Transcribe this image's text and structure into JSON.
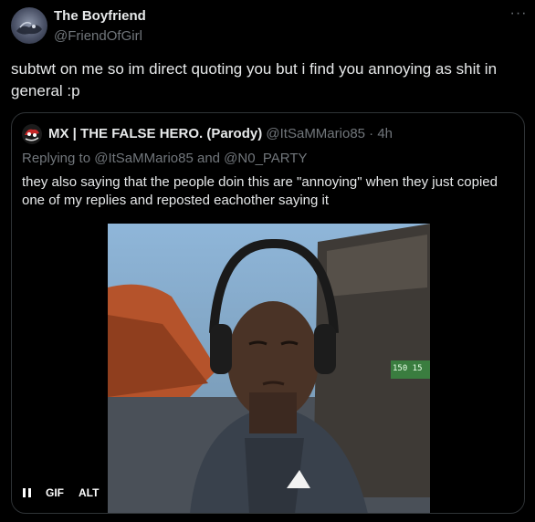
{
  "tweet": {
    "author_name": "The Boyfriend",
    "author_handle": "@FriendOfGirl",
    "more_glyph": "···",
    "text": "subtwt on me so im direct quoting you but i find you annoying as shit in general :p"
  },
  "quoted": {
    "author_name": "MX | THE FALSE HERO. (Parody)",
    "meta": "@ItSaMMario85 · 4h",
    "reply_prefix": "Replying to @ItSaMMario85 and @N0_PARTY",
    "text": "they also saying that the people doin this are \"annoying\" when they just copied one of my replies and reposted eachother saying it",
    "media": {
      "type": "gif",
      "overlay_score": "150 15"
    },
    "controls": {
      "gif_label": "GIF",
      "alt_label": "ALT"
    }
  },
  "icons": {
    "avatar": "avatar-image",
    "quoted_avatar": "mario-avatar",
    "pause": "pause-icon",
    "more": "more-icon"
  },
  "colors": {
    "background": "#000000",
    "text_primary": "#e7e9ea",
    "text_secondary": "#71767b",
    "border": "#2f3336"
  }
}
